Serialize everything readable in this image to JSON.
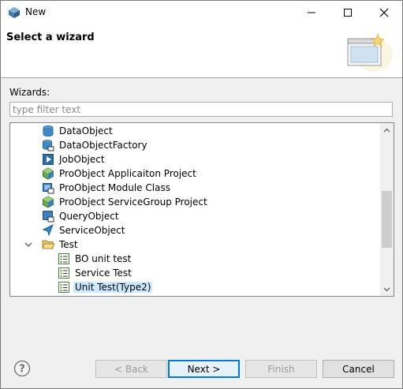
{
  "window": {
    "title": "New"
  },
  "banner": {
    "title": "Select a wizard"
  },
  "wizards": {
    "label": "Wizards:",
    "filter_placeholder": "type filter text",
    "filter_value": ""
  },
  "tree": {
    "items": [
      {
        "label": "DataObject",
        "icon": "data-object-icon"
      },
      {
        "label": "DataObjectFactory",
        "icon": "data-object-factory-icon"
      },
      {
        "label": "JobObject",
        "icon": "job-object-icon"
      },
      {
        "label": "ProObject Applicaiton Project",
        "icon": "proobject-project-icon"
      },
      {
        "label": "ProObject Module Class",
        "icon": "module-class-icon"
      },
      {
        "label": "ProObject ServiceGroup Project",
        "icon": "proobject-project-icon"
      },
      {
        "label": "QueryObject",
        "icon": "query-object-icon"
      },
      {
        "label": "ServiceObject",
        "icon": "service-object-icon"
      },
      {
        "label": "Test",
        "icon": "folder-open-icon",
        "expanded": true
      },
      {
        "label": "BO unit test",
        "icon": "test-list-icon"
      },
      {
        "label": "Service Test",
        "icon": "test-list-icon"
      },
      {
        "label": "Unit Test(Type2)",
        "icon": "test-list-icon",
        "selected": true
      }
    ]
  },
  "buttons": {
    "back": "< Back",
    "next": "Next >",
    "finish": "Finish",
    "cancel": "Cancel"
  },
  "colors": {
    "selection": "#cce8ff",
    "default_button_border": "#0078d7"
  }
}
